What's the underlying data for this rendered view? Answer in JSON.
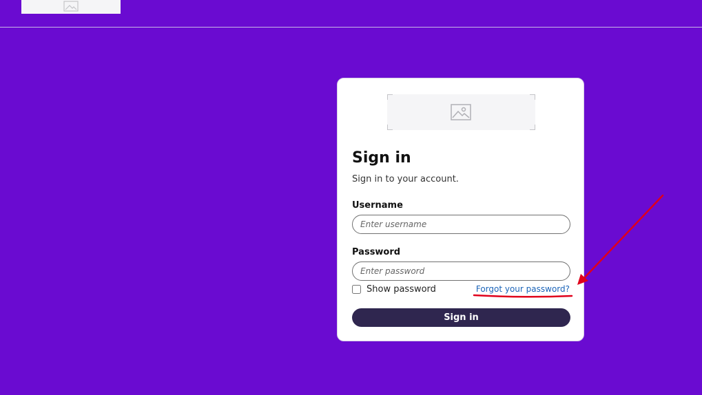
{
  "header": {
    "logo_icon": "image-placeholder-icon"
  },
  "login": {
    "logo_icon": "image-placeholder-icon",
    "title": "Sign in",
    "subtitle": "Sign in to your account.",
    "username_label": "Username",
    "username_placeholder": "Enter username",
    "username_value": "",
    "password_label": "Password",
    "password_placeholder": "Enter password",
    "password_value": "",
    "show_password_label": "Show password",
    "show_password_checked": false,
    "forgot_link": "Forgot your password?",
    "submit_label": "Sign in"
  },
  "colors": {
    "page_background": "#6a0bd1",
    "button_background": "#2f264f",
    "link": "#1a63b8",
    "annotation": "#e0001b"
  },
  "annotation": {
    "type": "red-arrow-and-underline",
    "target": "forgot-password-link"
  }
}
